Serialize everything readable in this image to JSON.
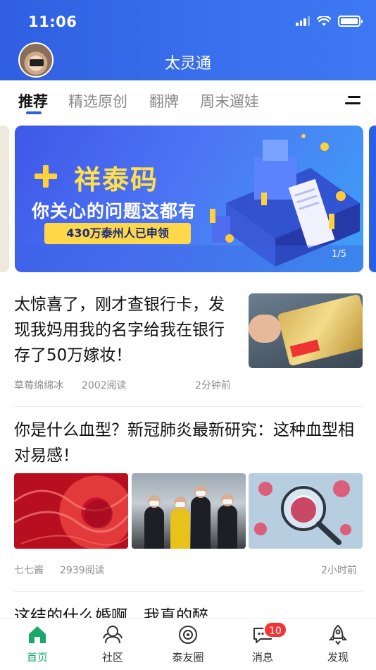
{
  "status_bar": {
    "time": "11:06"
  },
  "header": {
    "app_title": "太灵通"
  },
  "tabs": [
    {
      "label": "推荐",
      "active": true
    },
    {
      "label": "精选原创",
      "active": false
    },
    {
      "label": "翻牌",
      "active": false
    },
    {
      "label": "周末遛娃",
      "active": false
    }
  ],
  "banner": {
    "title": "祥泰码",
    "subtitle": "你关心的问题这都有",
    "pill": "430万泰州人已申领",
    "page_indicator": "1/5"
  },
  "articles": [
    {
      "title": "太惊喜了，刚才查银行卡，发现我妈用我的名字给我在银行存了50万嫁妆！",
      "author": "草莓绵绵冰",
      "reads": "2002阅读",
      "time": "2分钟前"
    },
    {
      "title": "你是什么血型？新冠肺炎最新研究：这种血型相对易感！",
      "author": "七七酱",
      "reads": "2939阅读",
      "time": "2小时前"
    },
    {
      "title": "这结的什么婚啊，我真的醉"
    }
  ],
  "tabbar": {
    "items": [
      {
        "label": "首页",
        "icon": "home-icon",
        "active": true
      },
      {
        "label": "社区",
        "icon": "community-icon",
        "active": false
      },
      {
        "label": "泰友圈",
        "icon": "circle-icon",
        "active": false
      },
      {
        "label": "消息",
        "icon": "message-icon",
        "active": false
      },
      {
        "label": "发现",
        "icon": "rocket-icon",
        "active": false
      }
    ],
    "message_badge": "10"
  },
  "colors": {
    "brand_blue": "#2f5fe0",
    "active_green": "#1aa86b",
    "badge_red": "#f03535"
  }
}
